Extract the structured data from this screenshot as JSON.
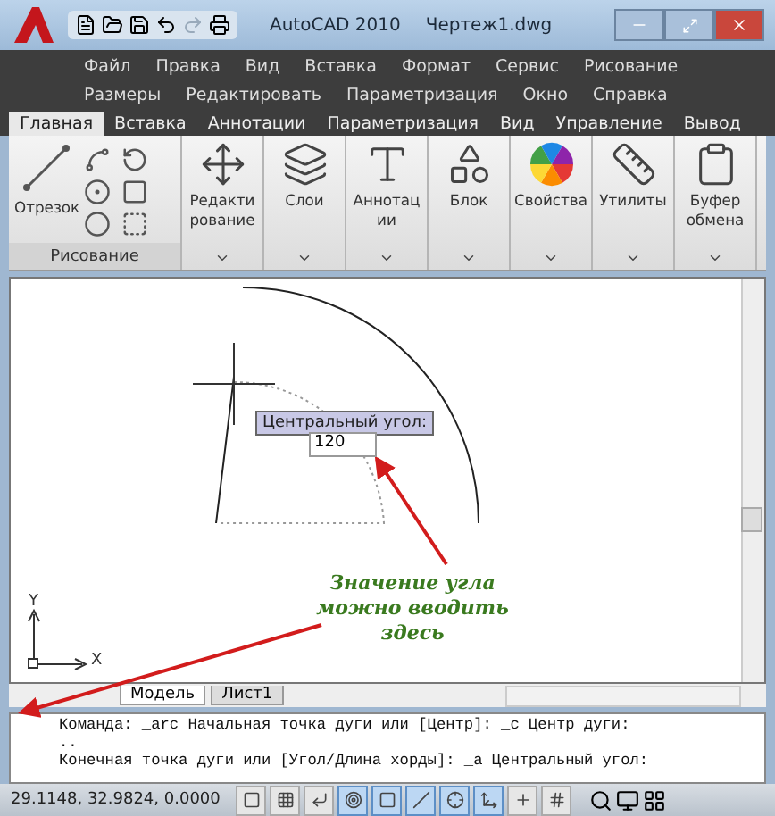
{
  "window": {
    "app": "AutoCAD 2010",
    "file": "Чертеж1.dwg"
  },
  "menu_rows": [
    [
      "Файл",
      "Правка",
      "Вид",
      "Вставка",
      "Формат",
      "Сервис",
      "Рисование"
    ],
    [
      "Размеры",
      "Редактировать",
      "Параметризация",
      "Окно",
      "Справка"
    ]
  ],
  "ribbon_tabs": [
    {
      "label": "Главная",
      "selected": true
    },
    {
      "label": "Вставка",
      "selected": false
    },
    {
      "label": "Аннотации",
      "selected": false
    },
    {
      "label": "Параметризация",
      "selected": false
    },
    {
      "label": "Вид",
      "selected": false
    },
    {
      "label": "Управление",
      "selected": false
    },
    {
      "label": "Вывод",
      "selected": false
    }
  ],
  "draw_panel": {
    "tool": "Отрезок",
    "title": "Рисование"
  },
  "panels": [
    {
      "kind": "edit",
      "label": "Редактирование"
    },
    {
      "kind": "layers",
      "label": "Слои"
    },
    {
      "kind": "annotation",
      "label": "Аннотации"
    },
    {
      "kind": "block",
      "label": "Блок"
    },
    {
      "kind": "properties",
      "label": "Свойства"
    },
    {
      "kind": "utilities",
      "label": "Утилиты"
    },
    {
      "kind": "clipboard",
      "label": "Буфер обмена"
    }
  ],
  "canvas": {
    "prompt_label": "Центральный угол:",
    "prompt_value": "120",
    "note": "Значение угла можно вводить здесь",
    "axis_y": "Y",
    "axis_x": "X"
  },
  "layout_tabs": [
    {
      "label": "Модель",
      "selected": true
    },
    {
      "label": "Лист1",
      "selected": false
    }
  ],
  "command_lines": [
    "Команда: _arc Начальная точка дуги или [Центр]: _c Центр дуги:",
    "..",
    "Конечная точка дуги или [Угол/Длина хорды]: _a Центральный угол:"
  ],
  "status_bar": {
    "coordinates": "29.1148, 32.9824, 0.0000",
    "toggles": [
      {
        "on": false
      },
      {
        "on": false
      },
      {
        "on": false
      },
      {
        "on": true
      },
      {
        "on": true
      },
      {
        "on": true
      },
      {
        "on": true
      },
      {
        "on": true
      },
      {
        "on": false
      },
      {
        "on": false
      }
    ]
  }
}
